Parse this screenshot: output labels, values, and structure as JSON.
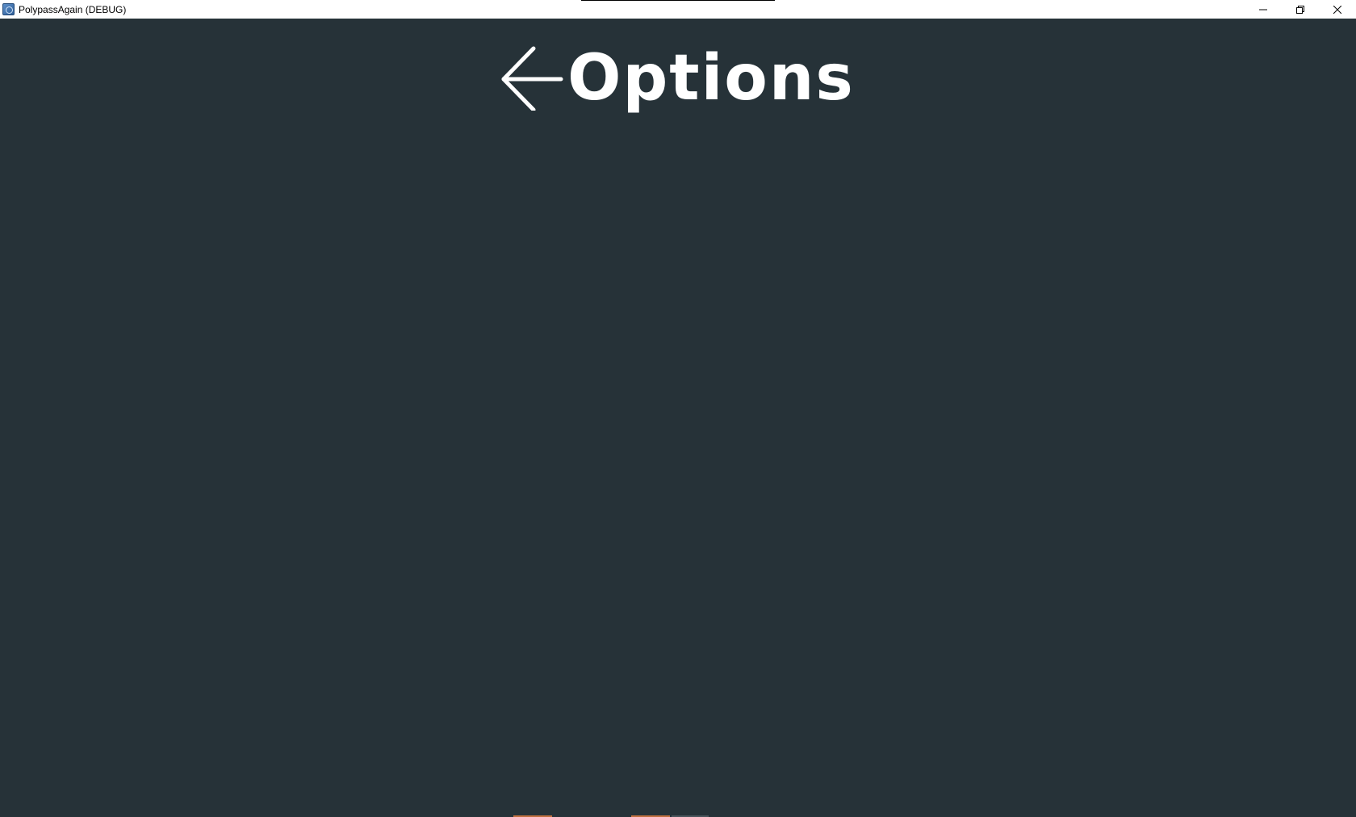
{
  "window": {
    "title": "PolypassAgain (DEBUG)",
    "controls": {
      "minimize_icon": "minimize-icon",
      "restore_icon": "restore-icon",
      "close_icon": "close-icon"
    }
  },
  "page": {
    "title": "Options",
    "back_icon": "arrow-left-icon"
  },
  "colors": {
    "background": "#263238",
    "titlebar": "#ffffff",
    "text": "#ffffff",
    "accent": "#c0703f"
  }
}
